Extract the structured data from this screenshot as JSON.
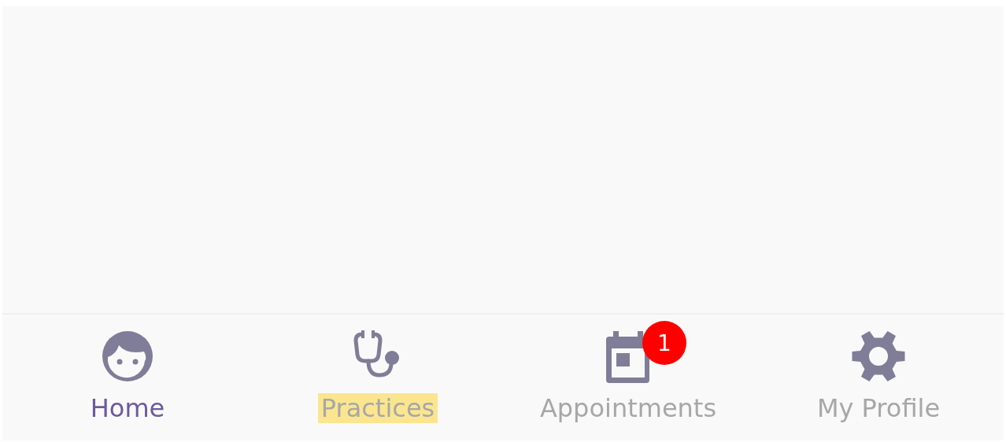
{
  "tab_bar": {
    "tabs": [
      {
        "label": "Home",
        "selected": true,
        "highlighted": false
      },
      {
        "label": "Practices",
        "selected": false,
        "highlighted": true
      },
      {
        "label": "Appointments",
        "selected": false,
        "highlighted": false,
        "badge": "1"
      },
      {
        "label": "My Profile",
        "selected": false,
        "highlighted": false
      }
    ]
  }
}
